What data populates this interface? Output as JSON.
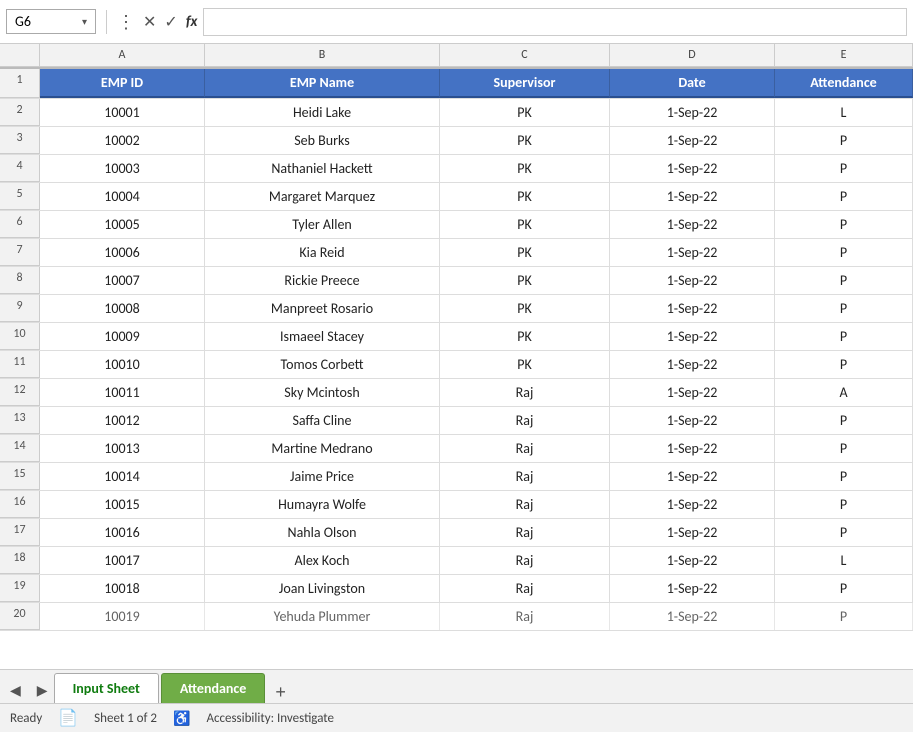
{
  "formulaBar": {
    "cellRef": "G6",
    "funcIcon": "fx"
  },
  "columns": {
    "headers": [
      "A",
      "B",
      "C",
      "D",
      "E"
    ],
    "labels": [
      "EMP ID",
      "EMP Name",
      "Supervisor",
      "Date",
      "Attendance"
    ]
  },
  "rows": [
    {
      "rowNum": 2,
      "empId": "10001",
      "empName": "Heidi Lake",
      "supervisor": "PK",
      "date": "1-Sep-22",
      "attendance": "L"
    },
    {
      "rowNum": 3,
      "empId": "10002",
      "empName": "Seb Burks",
      "supervisor": "PK",
      "date": "1-Sep-22",
      "attendance": "P"
    },
    {
      "rowNum": 4,
      "empId": "10003",
      "empName": "Nathaniel Hackett",
      "supervisor": "PK",
      "date": "1-Sep-22",
      "attendance": "P"
    },
    {
      "rowNum": 5,
      "empId": "10004",
      "empName": "Margaret Marquez",
      "supervisor": "PK",
      "date": "1-Sep-22",
      "attendance": "P"
    },
    {
      "rowNum": 6,
      "empId": "10005",
      "empName": "Tyler Allen",
      "supervisor": "PK",
      "date": "1-Sep-22",
      "attendance": "P"
    },
    {
      "rowNum": 7,
      "empId": "10006",
      "empName": "Kia Reid",
      "supervisor": "PK",
      "date": "1-Sep-22",
      "attendance": "P"
    },
    {
      "rowNum": 8,
      "empId": "10007",
      "empName": "Rickie Preece",
      "supervisor": "PK",
      "date": "1-Sep-22",
      "attendance": "P"
    },
    {
      "rowNum": 9,
      "empId": "10008",
      "empName": "Manpreet Rosario",
      "supervisor": "PK",
      "date": "1-Sep-22",
      "attendance": "P"
    },
    {
      "rowNum": 10,
      "empId": "10009",
      "empName": "Ismaeel Stacey",
      "supervisor": "PK",
      "date": "1-Sep-22",
      "attendance": "P"
    },
    {
      "rowNum": 11,
      "empId": "10010",
      "empName": "Tomos Corbett",
      "supervisor": "PK",
      "date": "1-Sep-22",
      "attendance": "P"
    },
    {
      "rowNum": 12,
      "empId": "10011",
      "empName": "Sky Mcintosh",
      "supervisor": "Raj",
      "date": "1-Sep-22",
      "attendance": "A"
    },
    {
      "rowNum": 13,
      "empId": "10012",
      "empName": "Saffa Cline",
      "supervisor": "Raj",
      "date": "1-Sep-22",
      "attendance": "P"
    },
    {
      "rowNum": 14,
      "empId": "10013",
      "empName": "Martine Medrano",
      "supervisor": "Raj",
      "date": "1-Sep-22",
      "attendance": "P"
    },
    {
      "rowNum": 15,
      "empId": "10014",
      "empName": "Jaime Price",
      "supervisor": "Raj",
      "date": "1-Sep-22",
      "attendance": "P"
    },
    {
      "rowNum": 16,
      "empId": "10015",
      "empName": "Humayra Wolfe",
      "supervisor": "Raj",
      "date": "1-Sep-22",
      "attendance": "P"
    },
    {
      "rowNum": 17,
      "empId": "10016",
      "empName": "Nahla Olson",
      "supervisor": "Raj",
      "date": "1-Sep-22",
      "attendance": "P"
    },
    {
      "rowNum": 18,
      "empId": "10017",
      "empName": "Alex Koch",
      "supervisor": "Raj",
      "date": "1-Sep-22",
      "attendance": "L"
    },
    {
      "rowNum": 19,
      "empId": "10018",
      "empName": "Joan Livingston",
      "supervisor": "Raj",
      "date": "1-Sep-22",
      "attendance": "P"
    },
    {
      "rowNum": 20,
      "empId": "10019",
      "empName": "Yehuda Plummer",
      "supervisor": "Raj",
      "date": "1-Sep-22",
      "attendance": "P"
    }
  ],
  "tabs": {
    "inputSheet": "Input Sheet",
    "attendance": "Attendance",
    "addIcon": "+"
  },
  "statusBar": {
    "ready": "Ready",
    "sheet": "Sheet 1 of 2",
    "accessibility": "Accessibility: Investigate"
  }
}
